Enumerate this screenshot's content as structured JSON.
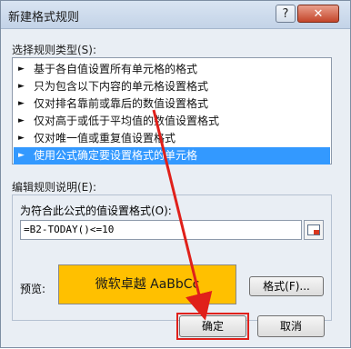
{
  "dialog": {
    "title": "新建格式规则",
    "help_button": "?",
    "close_button": "✕"
  },
  "rule_type": {
    "label": "选择规则类型(S):",
    "items": [
      {
        "label": "基于各自值设置所有单元格的格式",
        "selected": false
      },
      {
        "label": "只为包含以下内容的单元格设置格式",
        "selected": false
      },
      {
        "label": "仅对排名靠前或靠后的数值设置格式",
        "selected": false
      },
      {
        "label": "仅对高于或低于平均值的数值设置格式",
        "selected": false
      },
      {
        "label": "仅对唯一值或重复值设置格式",
        "selected": false
      },
      {
        "label": "使用公式确定要设置格式的单元格",
        "selected": true
      }
    ],
    "arrow_glyph": "►"
  },
  "edit_rule": {
    "label": "编辑规则说明(E):",
    "formula_label": "为符合此公式的值设置格式(O):",
    "formula_value": "=B2-TODAY()<=10",
    "preview_label": "预览:",
    "preview_text": "微软卓越  AaBbCc",
    "preview_color": "#ffc000",
    "format_button": "格式(F)..."
  },
  "buttons": {
    "ok": "确定",
    "cancel": "取消"
  },
  "annotation": {
    "color": "#e0201a"
  }
}
